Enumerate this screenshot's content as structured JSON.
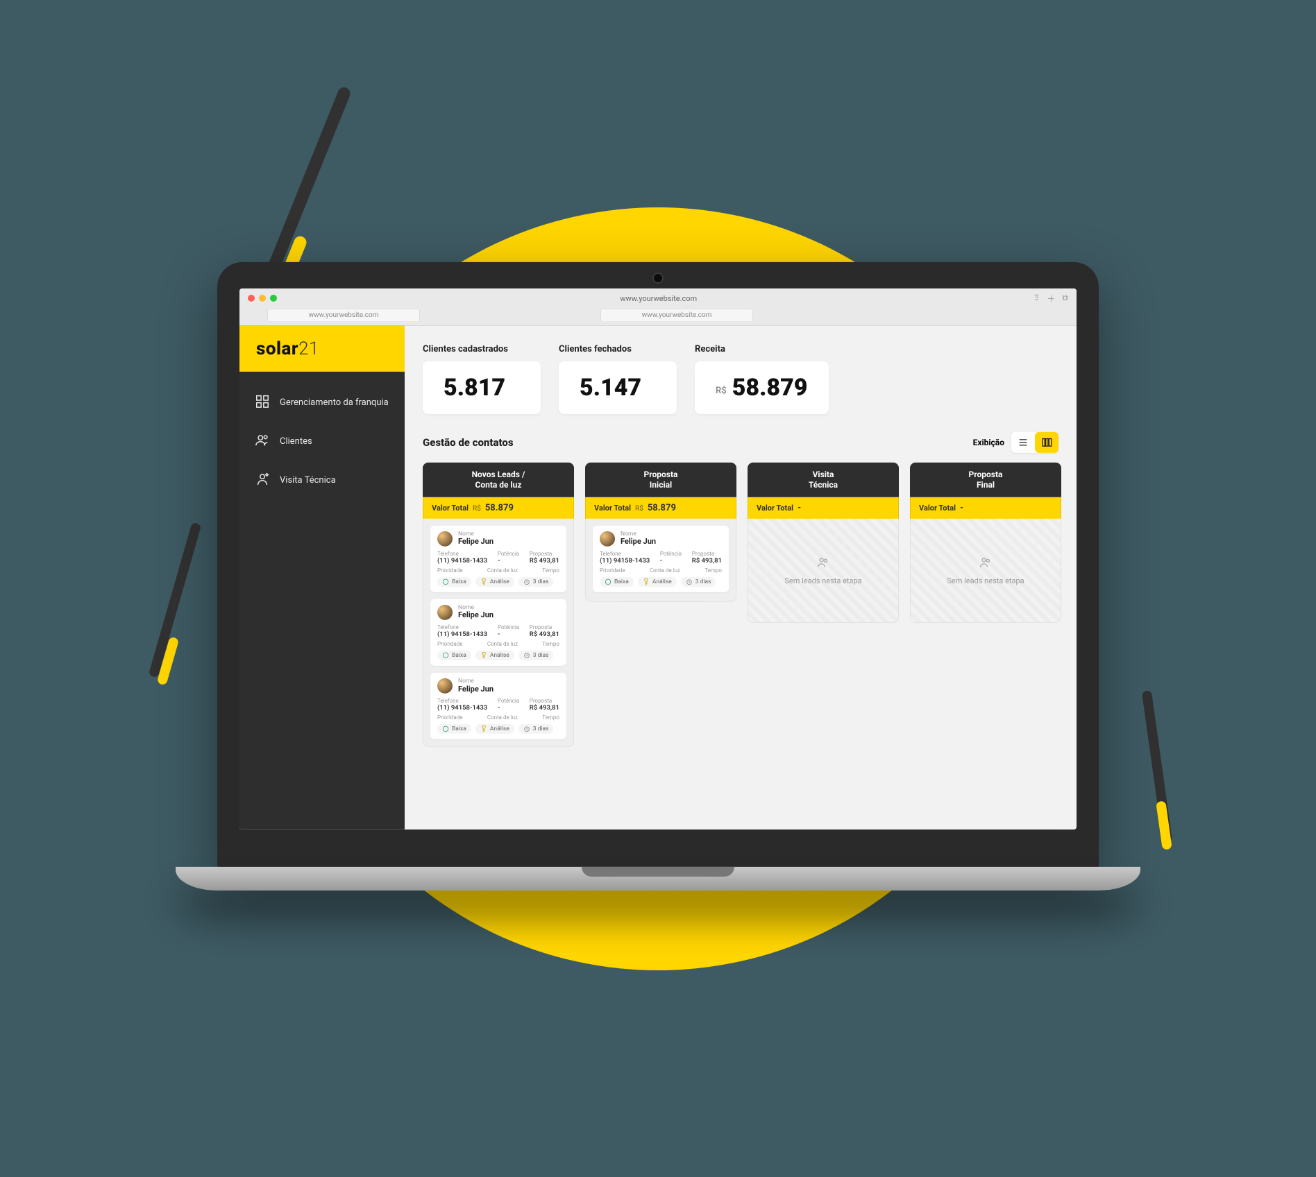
{
  "browser": {
    "title": "www.yourwebsite.com",
    "tabs": [
      "www.yourwebsite.com",
      "www.yourwebsite.com"
    ]
  },
  "brand": {
    "bold": "solar",
    "light": "21"
  },
  "sidebar": {
    "items": [
      {
        "label": "Gerenciamento da franquia"
      },
      {
        "label": "Clientes"
      },
      {
        "label": "Visita Técnica"
      }
    ]
  },
  "kpis": [
    {
      "label": "Clientes cadastrados",
      "prefix": "",
      "value": "5.817"
    },
    {
      "label": "Clientes fechados",
      "prefix": "",
      "value": "5.147"
    },
    {
      "label": "Receita",
      "prefix": "R$",
      "value": "58.879"
    }
  ],
  "contacts": {
    "title": "Gestão de contatos",
    "view_label": "Exibição",
    "total_label": "Valor Total",
    "currency": "R$",
    "empty_text": "Sem leads nesta etapa",
    "card_field_labels": {
      "name": "Nome",
      "phone": "Telefone",
      "power": "Potência",
      "proposal": "Proposta",
      "priority": "Prioridade",
      "bill": "Conta de luz",
      "time": "Tempo"
    },
    "columns": [
      {
        "title": "Novos Leads /\nConta de luz",
        "total": "58.879",
        "cards": [
          {
            "name": "Felipe Jun",
            "phone": "(11) 94158-1433",
            "power": "-",
            "proposal": "R$ 493,81",
            "priority": "Baixa",
            "bill": "Análise",
            "time": "3 dias"
          },
          {
            "name": "Felipe Jun",
            "phone": "(11) 94158-1433",
            "power": "-",
            "proposal": "R$ 493,81",
            "priority": "Baixa",
            "bill": "Análise",
            "time": "3 dias"
          },
          {
            "name": "Felipe Jun",
            "phone": "(11) 94158-1433",
            "power": "-",
            "proposal": "R$ 493,81",
            "priority": "Baixa",
            "bill": "Análise",
            "time": "3 dias"
          }
        ]
      },
      {
        "title": "Proposta\nInicial",
        "total": "58.879",
        "cards": [
          {
            "name": "Felipe Jun",
            "phone": "(11) 94158-1433",
            "power": "-",
            "proposal": "R$ 493,81",
            "priority": "Baixa",
            "bill": "Análise",
            "time": "3 dias"
          }
        ]
      },
      {
        "title": "Visita\nTécnica",
        "total": "-",
        "cards": []
      },
      {
        "title": "Proposta\nFinal",
        "total": "-",
        "cards": []
      }
    ]
  }
}
